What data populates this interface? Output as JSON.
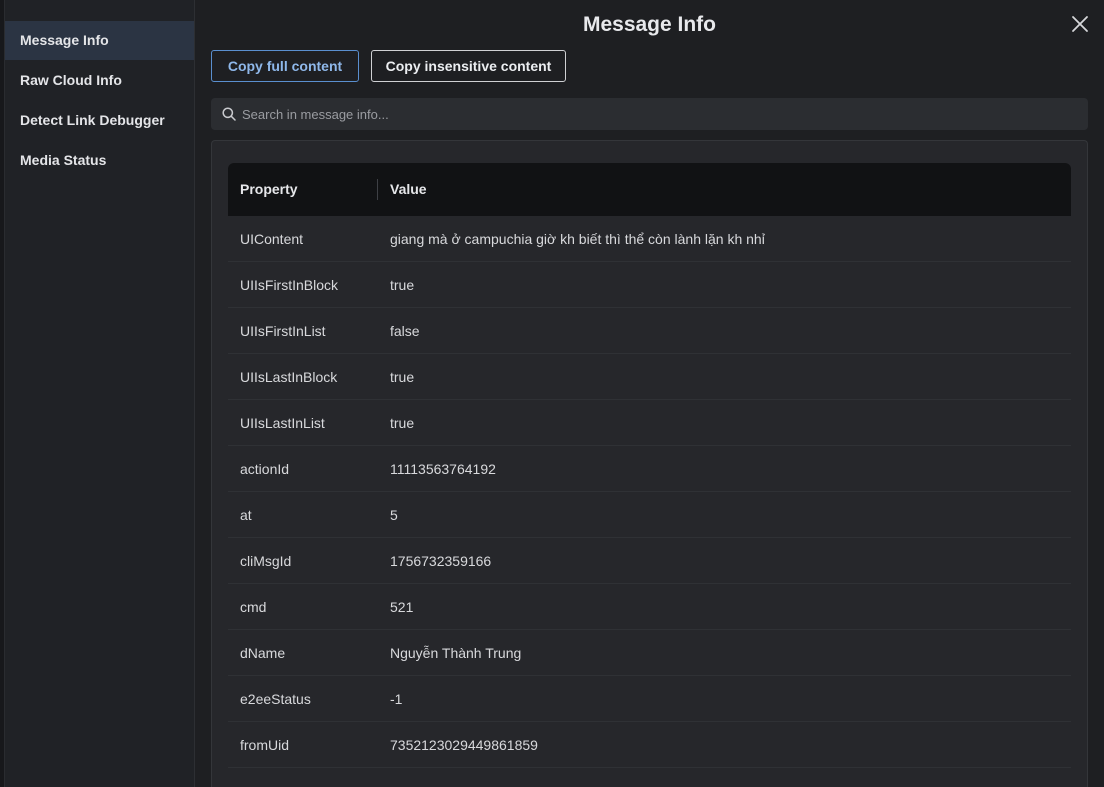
{
  "sidebar": {
    "items": [
      {
        "label": "Message Info",
        "active": true
      },
      {
        "label": "Raw Cloud Info",
        "active": false
      },
      {
        "label": "Detect Link Debugger",
        "active": false
      },
      {
        "label": "Media Status",
        "active": false
      }
    ]
  },
  "header": {
    "title": "Message Info",
    "close_icon": "close-icon"
  },
  "toolbar": {
    "copy_full_label": "Copy full content",
    "copy_insensitive_label": "Copy insensitive content"
  },
  "search": {
    "placeholder": "Search in message info...",
    "value": "",
    "icon": "search-icon"
  },
  "table": {
    "columns": [
      "Property",
      "Value"
    ],
    "rows": [
      {
        "property": "UIContent",
        "value": "giang mà ở campuchia giờ kh biết thì thể còn lành lặn kh nhỉ"
      },
      {
        "property": "UIIsFirstInBlock",
        "value": "true"
      },
      {
        "property": "UIIsFirstInList",
        "value": "false"
      },
      {
        "property": "UIIsLastInBlock",
        "value": "true"
      },
      {
        "property": "UIIsLastInList",
        "value": "true"
      },
      {
        "property": "actionId",
        "value": "11113563764192"
      },
      {
        "property": "at",
        "value": "5"
      },
      {
        "property": "cliMsgId",
        "value": "1756732359166"
      },
      {
        "property": "cmd",
        "value": "521"
      },
      {
        "property": "dName",
        "value": "Nguyễn Thành Trung"
      },
      {
        "property": "e2eeStatus",
        "value": "-1"
      },
      {
        "property": "fromUid",
        "value": "7352123029449861859"
      }
    ]
  },
  "colors": {
    "accent": "#5a8fcf",
    "active_nav_bg": "#2b3443",
    "table_header_bg": "#111214"
  }
}
